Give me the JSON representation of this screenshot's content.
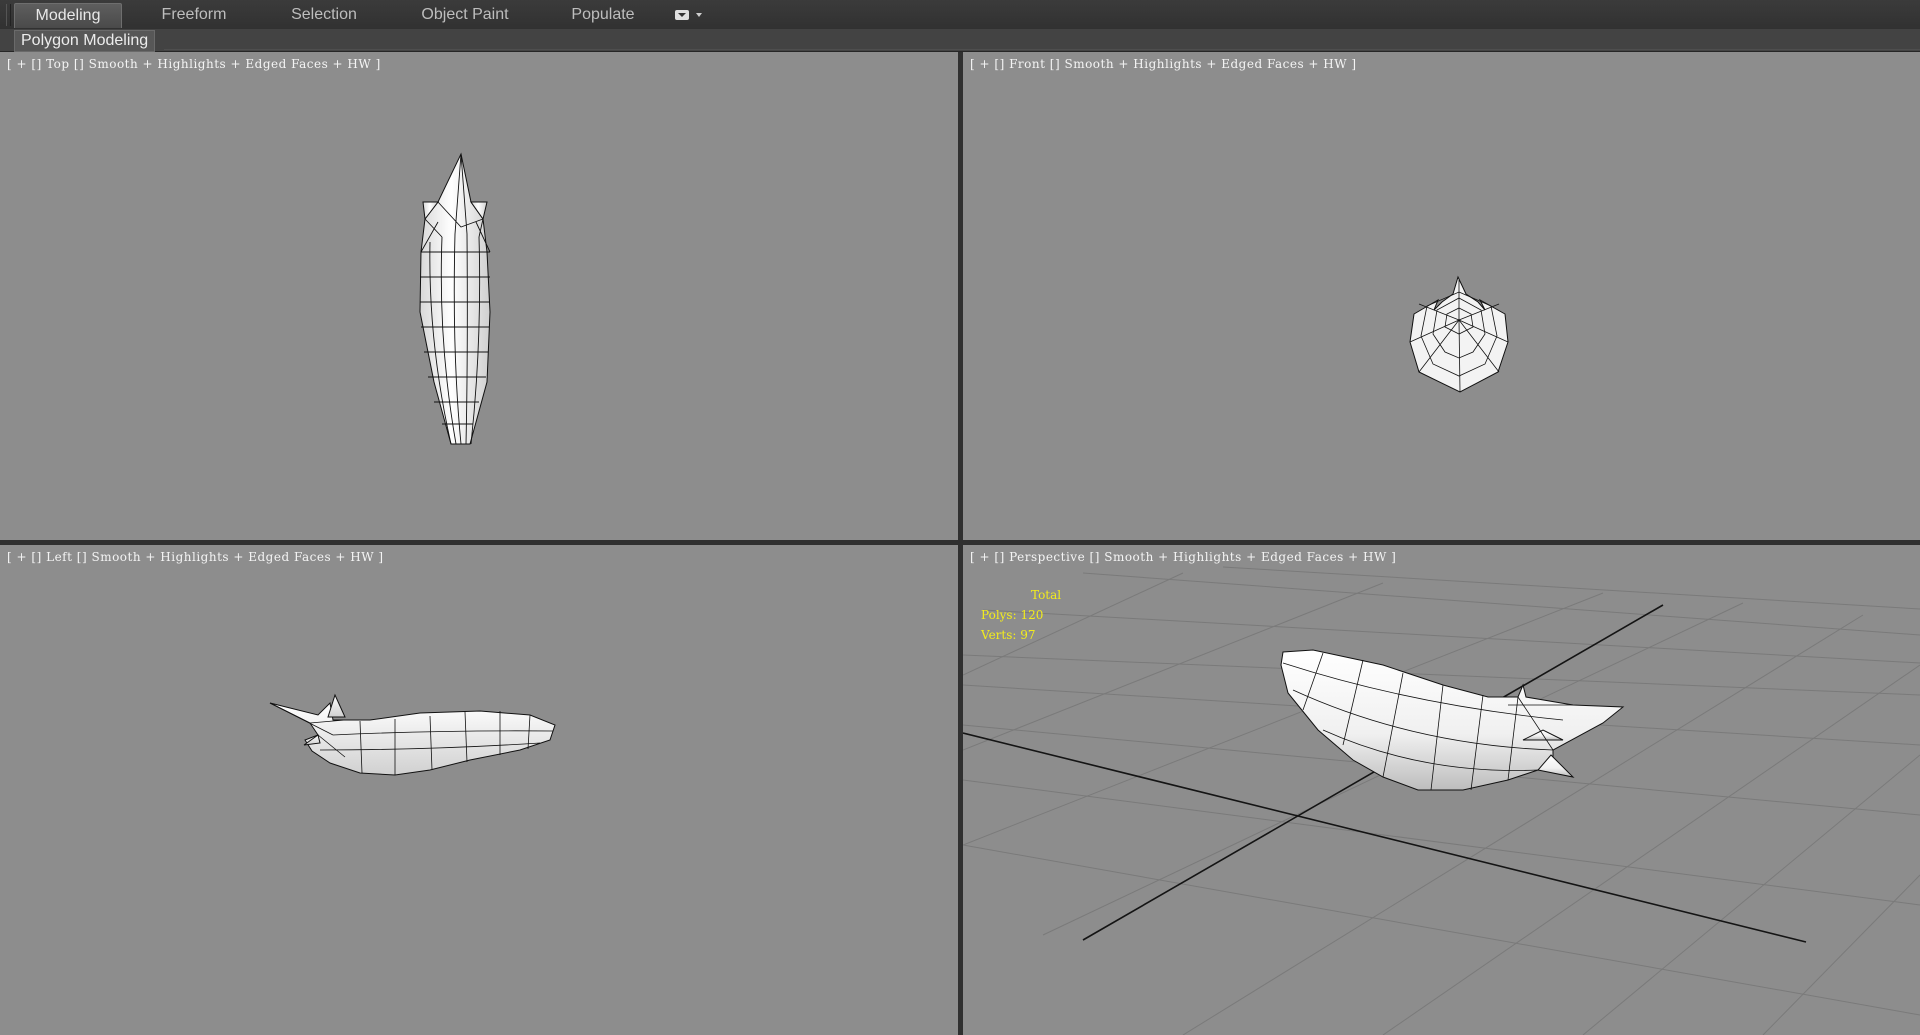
{
  "ribbon": {
    "tabs": [
      {
        "label": "Modeling",
        "active": true
      },
      {
        "label": "Freeform",
        "active": false
      },
      {
        "label": "Selection",
        "active": false
      },
      {
        "label": "Object Paint",
        "active": false
      },
      {
        "label": "Populate",
        "active": false
      }
    ],
    "panel_label": "Polygon Modeling"
  },
  "viewports": {
    "top": {
      "view": "Top",
      "shading": "Smooth + Highlights + Edged Faces + HW"
    },
    "front": {
      "view": "Front",
      "shading": "Smooth + Highlights + Edged Faces + HW"
    },
    "left": {
      "view": "Left",
      "shading": "Smooth + Highlights + Edged Faces + HW"
    },
    "perspective": {
      "view": "Perspective",
      "shading": "Smooth + Highlights + Edged Faces + HW"
    }
  },
  "stats": {
    "header": "Total",
    "polys_label": "Polys:",
    "polys": "120",
    "verts_label": "Verts:",
    "verts": "97"
  },
  "label_tokens": {
    "open": "[",
    "plus": "+",
    "sep": "[]",
    "close": "]"
  },
  "colors": {
    "viewport_bg": "#8d8d8d",
    "stats_text": "#f2ec1c",
    "grid_line": "#777777",
    "mesh_fill": "#f2f2f2"
  }
}
